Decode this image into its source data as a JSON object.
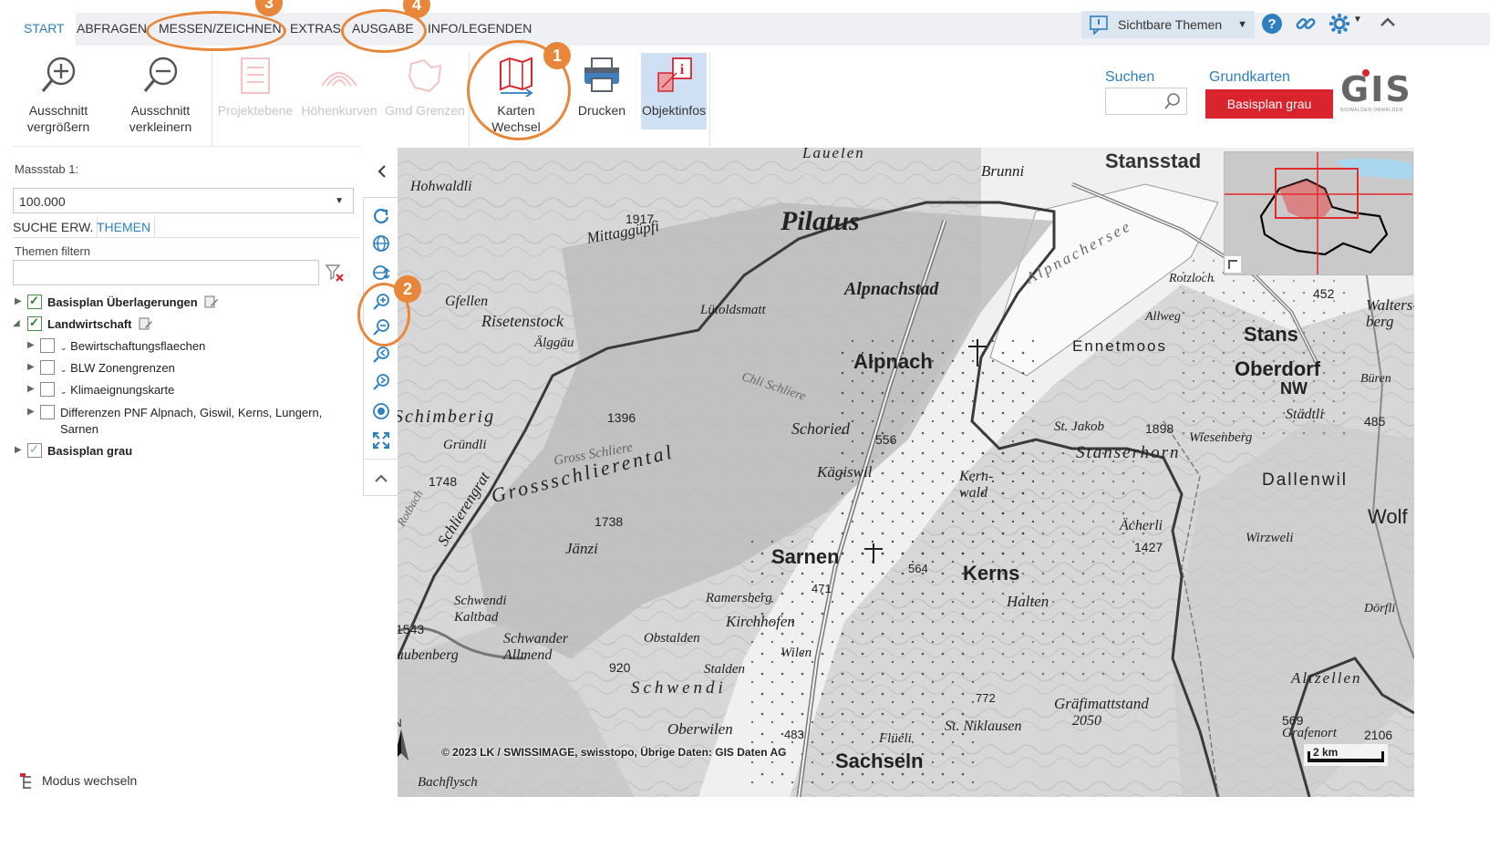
{
  "tabs": [
    {
      "label": "START",
      "active": true
    },
    {
      "label": "ABFRAGEN"
    },
    {
      "label": "MESSEN/ZEICHNEN"
    },
    {
      "label": "EXTRAS"
    },
    {
      "label": "AUSGABE"
    },
    {
      "label": "INFO/LEGENDEN"
    }
  ],
  "annotations": [
    "1",
    "2",
    "3",
    "4"
  ],
  "topright": {
    "visible_topics": "Sichtbare Themen"
  },
  "ribbon": {
    "zoom_in": "Ausschnitt vergrößern",
    "zoom_out": "Ausschnitt verkleinern",
    "project_level": "Projektebene",
    "contours": "Höhenkurven",
    "boundaries": "Gmd Grenzen",
    "switch_maps": "Karten Wechsel",
    "print": "Drucken",
    "object_info": "Objektinfos"
  },
  "search": {
    "label": "Suchen",
    "placeholder": ""
  },
  "basemaps": {
    "label": "Grundkarten",
    "button": "Basisplan grau"
  },
  "logo": {
    "text": "GIS",
    "sub": "NIDWALDEN OBWALDEN"
  },
  "left": {
    "scale_label": "Massstab 1:",
    "scale_value": "100.000",
    "tab_search": "SUCHE ERW.",
    "tab_topics": "THEMEN",
    "filter_label": "Themen filtern",
    "filter_value": "",
    "tree": {
      "basisplan_overlays": "Basisplan Überlagerungen",
      "agriculture": "Landwirtschaft",
      "cultivation": "Bewirtschaftungsflaechen",
      "blw_zones": "BLW Zonengrenzen",
      "climate": "Klimaeignungskarte",
      "pnf_diff_1": "Differenzen PNF Alpnach, Giswil, Kerns, Lungern,",
      "pnf_diff_2": "Sarnen",
      "basisplan_grey": "Basisplan grau"
    },
    "mode_switch": "Modus wechseln"
  },
  "map": {
    "copyright": "© 2023 LK / SWISSIMAGE, swisstopo, Übrige Daten: GIS Daten AG",
    "scalebar": "2 km",
    "north": "N",
    "places": {
      "Pilatus": "Pilatus",
      "Alpnachstad": "Alpnachstad",
      "Alpnach": "Alpnach",
      "Sarnen": "Sarnen",
      "Kerns": "Kerns",
      "Sachseln": "Sachseln",
      "Stansstad": "Stansstad",
      "Stans": "Stans",
      "Oberdorf": "Oberdorf",
      "Ennetmoos": "Ennetmoos",
      "Schoried": "Schoried",
      "Kaegiswil": "Kägiswil",
      "Grossschlierental": "Grossschlierental",
      "Schlierengrat": "Schlierengrat",
      "Schwendi": "Schwendi",
      "Kirchhofen": "Kirchhofen",
      "Ramersberg": "Ramersberg",
      "Wilen": "Wilen",
      "Stalden": "Stalden",
      "Oberwilen": "Oberwilen",
      "Flueli": "Flüeli",
      "StNiklausen": "St. Niklausen",
      "Graefimattstand": "Gräfimattstand",
      "Halten": "Halten",
      "Kernwald": "Kern-\nwald",
      "Stanserhorn": "Stanserhorn",
      "Dallenwil": "Dallenwil",
      "Wiesenberg": "Wiesenberg",
      "Wirzweli": "Wirzweli",
      "Aecherli": "Ächerli",
      "Altzellen": "Altzellen",
      "Grafenort": "Grafenort",
      "Wolf": "Wolf",
      "Dorfli": "Dörfli",
      "Staedtli": "Städtli",
      "Bueren": "Büren",
      "Waltersberg": "Walters-\nberg",
      "StJakob": "St. Jakob",
      "Allweg": "Allweg",
      "Rotzloch": "Rotzloch",
      "Alpnachersee": "Alpnachersee",
      "Brunni": "Brunni",
      "Lauelen": "Lauelen",
      "Hohwaldli": "Hohwaldli",
      "Mittaggupfi": "Mittaggüpfi",
      "Gfellen": "Gfellen",
      "Risetenstock": "Risetenstock",
      "Alggaeu": "Älggäu",
      "Lutoldsmatt": "Lütoldsmatt",
      "ChliSchliere": "Chli Schliere",
      "GrossSchliere": "Gross Schliere",
      "Jaenzi": "Jänzi",
      "SchwendiKaltbad": "Schwendi\nKaltbad",
      "SchwandAllmend": "Schwander\nAllmend",
      "Obstalden": "Obstalden",
      "Grundli": "Gründli",
      "Bachflysch": "Bachflysch",
      "Schimberig": "Schimberig",
      "Laubenberg": "Laubenberg",
      "Rotbach": "Rotbach",
      "NW": "NW"
    },
    "heights": [
      "1917",
      "1396",
      "556",
      "1738",
      "920",
      "471",
      "564",
      "483",
      "772",
      "2050",
      "1427",
      "1898",
      "485",
      "1748",
      "1543",
      "452",
      "2106",
      "569"
    ]
  },
  "colors": {
    "accent": "#2d7fc1",
    "orange": "#e8873a",
    "red": "#d9232d"
  }
}
